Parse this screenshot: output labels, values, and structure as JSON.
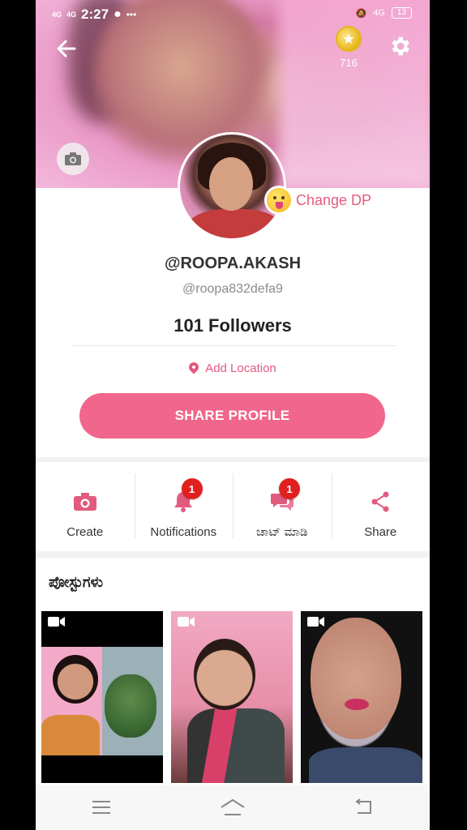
{
  "statusbar": {
    "signal1": "4G",
    "signal2": "4G",
    "time": "2:27",
    "net": "4G",
    "battery": "13"
  },
  "header": {
    "coin_count": "716"
  },
  "profile": {
    "change_dp_label": "Change DP",
    "username": "@ROOPA.AKASH",
    "handle": "@roopa832defa9",
    "followers": "101 Followers",
    "location_label": "Add Location",
    "share_profile_label": "SHARE PROFILE"
  },
  "actions": [
    {
      "label": "Create",
      "icon": "camera-icon"
    },
    {
      "label": "Notifications",
      "icon": "bell-icon",
      "badge": "1"
    },
    {
      "label": "ಚಾಟ್ ಮಾಡಿ",
      "icon": "chat-icon",
      "badge": "1"
    },
    {
      "label": "Share",
      "icon": "share-icon"
    }
  ],
  "posts": {
    "title": "ಪೋಸ್ಟುಗಳು"
  },
  "colors": {
    "accent": "#f0668c",
    "accent_text": "#e25b7f",
    "badge": "#e02020"
  }
}
